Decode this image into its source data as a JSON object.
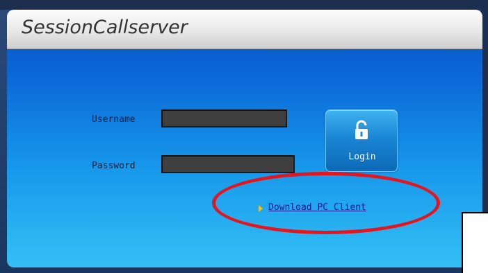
{
  "app": {
    "title": "SessionCallserver"
  },
  "form": {
    "username_label": "Username",
    "password_label": "Password",
    "username_value": "",
    "password_value": ""
  },
  "login_button": {
    "label": "Login",
    "icon": "unlocked-padlock-icon"
  },
  "download": {
    "label": "Download PC Client",
    "icon": "arrow-right-icon"
  },
  "colors": {
    "panel_top": "#0a52c0",
    "panel_bottom": "#33c0f5",
    "highlight": "#e8141b",
    "link": "#0b1a8a",
    "arrow": "#f2c21a"
  }
}
